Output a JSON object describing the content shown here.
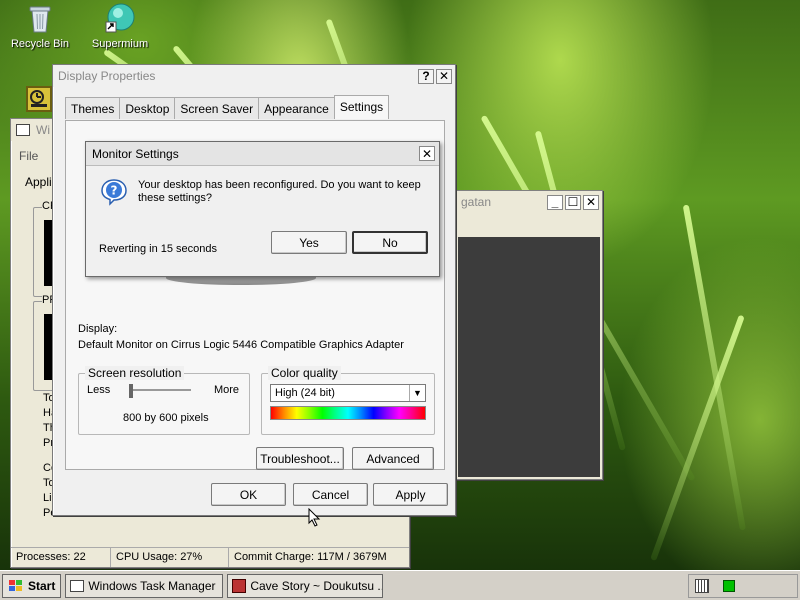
{
  "desktop": {
    "icons": [
      {
        "label": "Recycle Bin"
      },
      {
        "label": "Supermium"
      }
    ]
  },
  "task_manager": {
    "title_partial": "Wi",
    "menu": [
      "File",
      "O"
    ],
    "tab_partial": "Applic",
    "group_labels": [
      "CF",
      "PF"
    ],
    "left_letters": [
      "To",
      "Ha",
      "Th",
      "Pr",
      "Co",
      "To",
      "Lin",
      "Pe"
    ],
    "status": {
      "processes": "Processes: 22",
      "cpu": "CPU Usage: 27%",
      "commit": "Commit Charge: 117M / 3679M"
    }
  },
  "cave_story_window": {
    "title_partial": "gatan"
  },
  "display_properties": {
    "title": "Display Properties",
    "help_btn": "?",
    "close_btn": "✕",
    "tabs": [
      "Themes",
      "Desktop",
      "Screen Saver",
      "Appearance",
      "Settings"
    ],
    "active_tab": "Settings",
    "display_label": "Display:",
    "display_value": "Default Monitor on Cirrus Logic 5446 Compatible Graphics Adapter",
    "resolution": {
      "group_label": "Screen resolution",
      "less": "Less",
      "more": "More",
      "value_text": "800 by 600 pixels",
      "position": 0.0
    },
    "color_quality": {
      "group_label": "Color quality",
      "selected": "High (24 bit)"
    },
    "buttons": {
      "troubleshoot": "Troubleshoot...",
      "advanced": "Advanced",
      "ok": "OK",
      "cancel": "Cancel",
      "apply": "Apply"
    }
  },
  "monitor_dialog": {
    "title": "Monitor Settings",
    "close_btn": "✕",
    "message": "Your desktop has been reconfigured.  Do you want to keep these settings?",
    "countdown": "Reverting in 15 seconds",
    "yes": "Yes",
    "no": "No"
  },
  "taskbar": {
    "start": "Start",
    "items": [
      "Windows Task Manager",
      "Cave Story ~ Doukutsu ..."
    ]
  },
  "colors": {
    "window_bg": "#f0f0f0",
    "desktop_grass": "#5e9a22",
    "cave_story_client": "#3c3c3c",
    "tray_green": "#00c000"
  }
}
